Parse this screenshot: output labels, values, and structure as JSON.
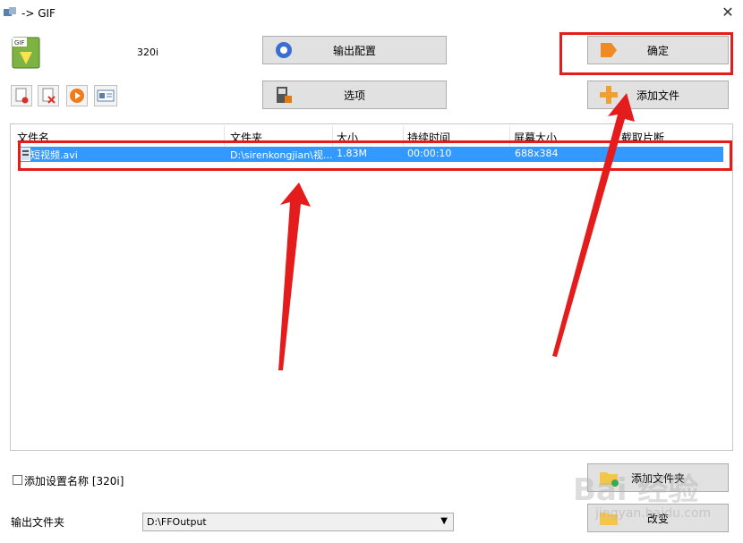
{
  "window": {
    "title": "-> GIF"
  },
  "profile_label": "320i",
  "buttons": {
    "output_config": "输出配置",
    "options": "选项",
    "ok": "确定",
    "add_file": "添加文件",
    "add_folder": "添加文件夹",
    "change": "改变"
  },
  "file_list": {
    "columns": [
      "文件名",
      "文件夹",
      "大小",
      "持续时间",
      "屏幕大小",
      "截取片断"
    ],
    "rows": [
      {
        "name": "短视频.avi",
        "folder": "D:\\sirenkongjian\\视...",
        "size": "1.83M",
        "duration": "00:00:10",
        "screen": "688x384",
        "clip": ""
      }
    ]
  },
  "add_setting_name": {
    "label": "添加设置名称 [320i]",
    "checked": false
  },
  "output": {
    "label": "输出文件夹",
    "value": "D:\\FFOutput"
  },
  "watermark": {
    "text": "Bai 经验",
    "sub": "jingyan.baidu.com"
  },
  "colors": {
    "selection": "#3399ff",
    "annotation": "#e51c1c"
  }
}
